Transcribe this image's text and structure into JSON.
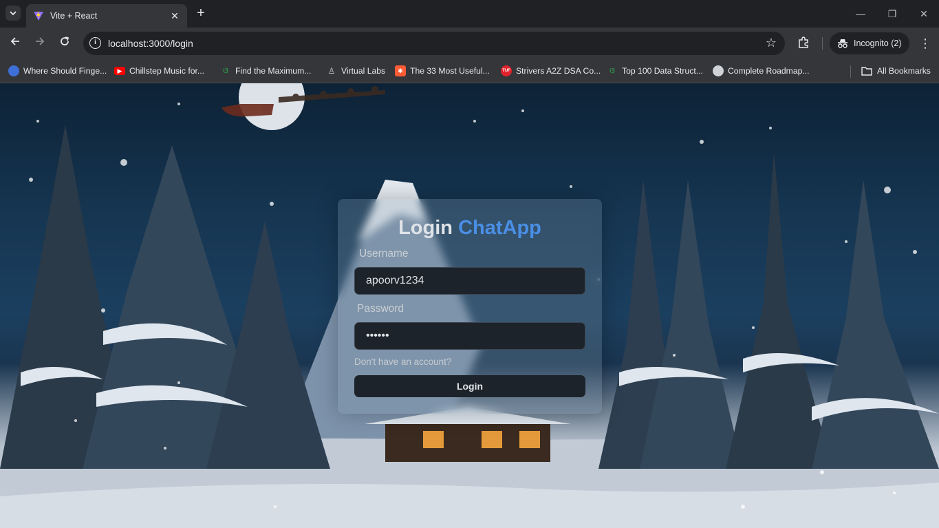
{
  "browser": {
    "tab": {
      "title": "Vite + React"
    },
    "url": "localhost:3000/login",
    "profile_label": "Incognito (2)",
    "bookmarks": [
      {
        "label": "Where Should Finge...",
        "icon": "globe-blue-icon"
      },
      {
        "label": "Chillstep Music for...",
        "icon": "youtube-icon"
      },
      {
        "label": "Find the Maximum...",
        "icon": "gfg-icon"
      },
      {
        "label": "Virtual Labs",
        "icon": "virtual-labs-icon"
      },
      {
        "label": "The 33 Most Useful...",
        "icon": "hubspot-icon"
      },
      {
        "label": "Strivers A2Z DSA Co...",
        "icon": "tuf-icon"
      },
      {
        "label": "Top 100 Data Struct...",
        "icon": "gfg-icon"
      },
      {
        "label": "Complete Roadmap...",
        "icon": "globe-icon"
      }
    ],
    "all_bookmarks_label": "All Bookmarks"
  },
  "login": {
    "title": "Login",
    "brand": "ChatApp",
    "username_label": "Username",
    "username_value": "apoorv1234",
    "password_label": "Password",
    "password_value": "••••••",
    "signup_link": "Don't have an account?",
    "submit_label": "Login"
  },
  "colors": {
    "brand": "#4a8fe6",
    "input_bg": "#1d232a",
    "browser_frame": "#35363a"
  }
}
